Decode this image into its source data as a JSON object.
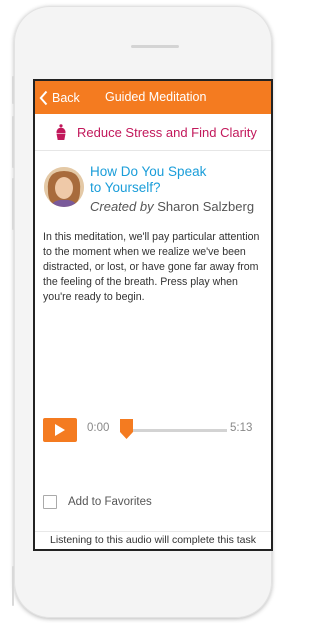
{
  "navbar": {
    "back_label": "Back",
    "title": "Guided Meditation"
  },
  "course": {
    "title": "Reduce Stress and Find Clarity",
    "icon": "cupcake-icon"
  },
  "meditation": {
    "title_line1": "How Do You Speak",
    "title_line2": "to Yourself?",
    "created_prefix": "Created by",
    "author": "Sharon Salzberg",
    "description": "In this meditation, we'll pay particular attention to the moment when we realize we've been distracted, or lost, or have gone far away from the feeling of the breath. Press play when you're ready to begin."
  },
  "player": {
    "current_time": "0:00",
    "total_time": "5:13",
    "progress": 0
  },
  "favorites": {
    "label": "Add to Favorites",
    "checked": false
  },
  "footer": {
    "hint": "Listening to this audio will complete this task"
  },
  "colors": {
    "accent": "#f47b20",
    "link": "#1a9dd9",
    "course": "#c2185b"
  }
}
